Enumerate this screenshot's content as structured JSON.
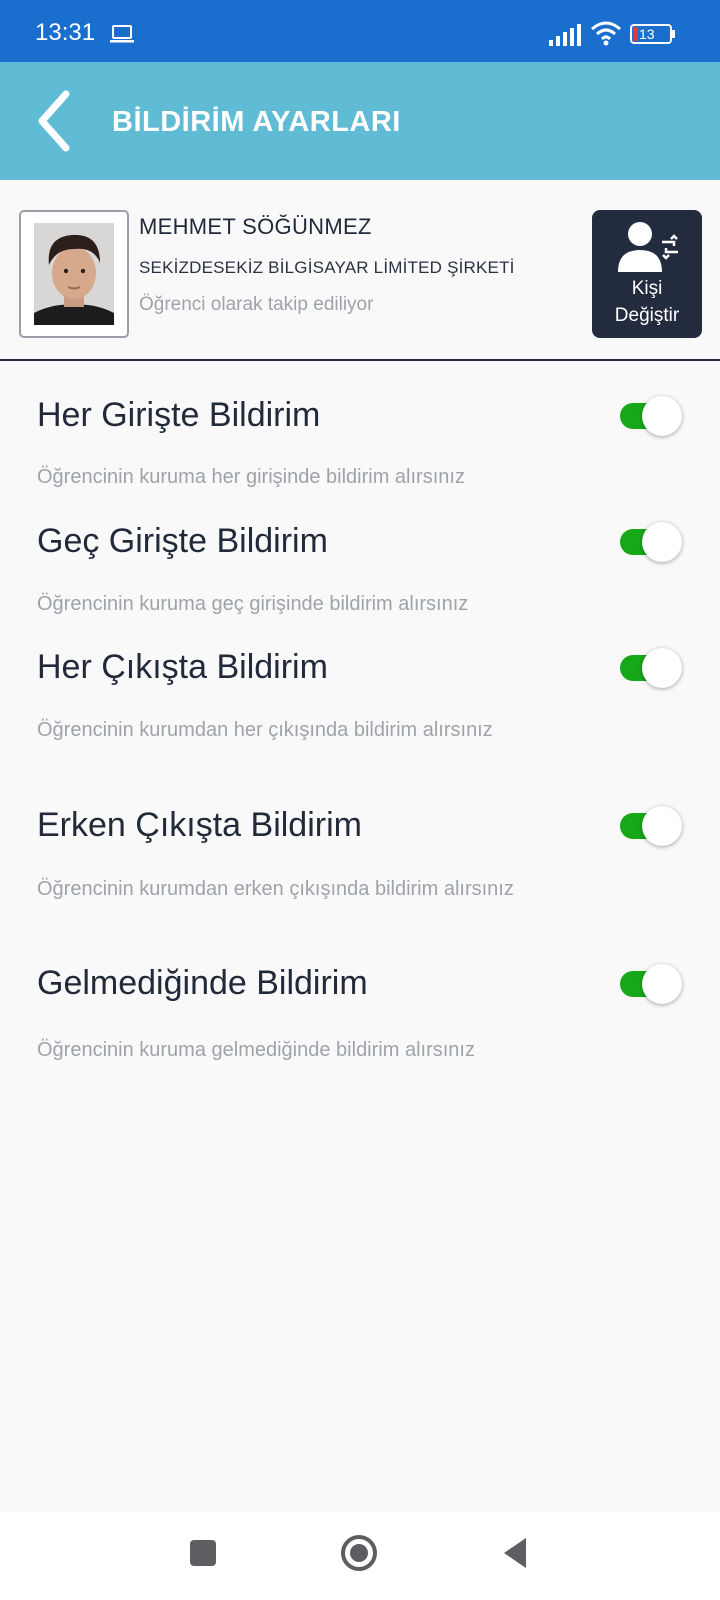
{
  "status_bar": {
    "time": "13:31",
    "battery_level": "13",
    "icons": [
      "laptop-icon",
      "signal-icon",
      "wifi-icon",
      "battery-icon"
    ]
  },
  "app_bar": {
    "title": "BİLDİRİM AYARLARI",
    "back_icon": "chevron-left-icon"
  },
  "profile": {
    "name": "MEHMET SÖĞÜNMEZ",
    "company": "SEKİZDESEKİZ BİLGİSAYAR LİMİTED ŞİRKETİ",
    "status": "Öğrenci olarak takip ediliyor",
    "change_button_line1": "Kişi",
    "change_button_line2": "Değiştir"
  },
  "settings": [
    {
      "title": "Her Girişte Bildirim",
      "description": "Öğrencinin kuruma her girişinde bildirim alırsınız",
      "enabled": true
    },
    {
      "title": "Geç Girişte Bildirim",
      "description": "Öğrencinin kuruma geç girişinde bildirim alırsınız",
      "enabled": true
    },
    {
      "title": "Her Çıkışta Bildirim",
      "description": "Öğrencinin kurumdan her çıkışında bildirim alırsınız",
      "enabled": true
    },
    {
      "title": "Erken Çıkışta Bildirim",
      "description": "Öğrencinin kurumdan erken çıkışında bildirim alırsınız",
      "enabled": true
    },
    {
      "title": "Gelmediğinde Bildirim",
      "description": "Öğrencinin kuruma gelmediğinde bildirim alırsınız",
      "enabled": true
    }
  ],
  "colors": {
    "status_bar": "#1a6fce",
    "app_bar": "#5fbcd4",
    "toggle_on": "#17a817",
    "dark": "#232b3e"
  },
  "nav_bar": {
    "icons": [
      "recents-square-icon",
      "home-circle-icon",
      "back-triangle-icon"
    ]
  }
}
